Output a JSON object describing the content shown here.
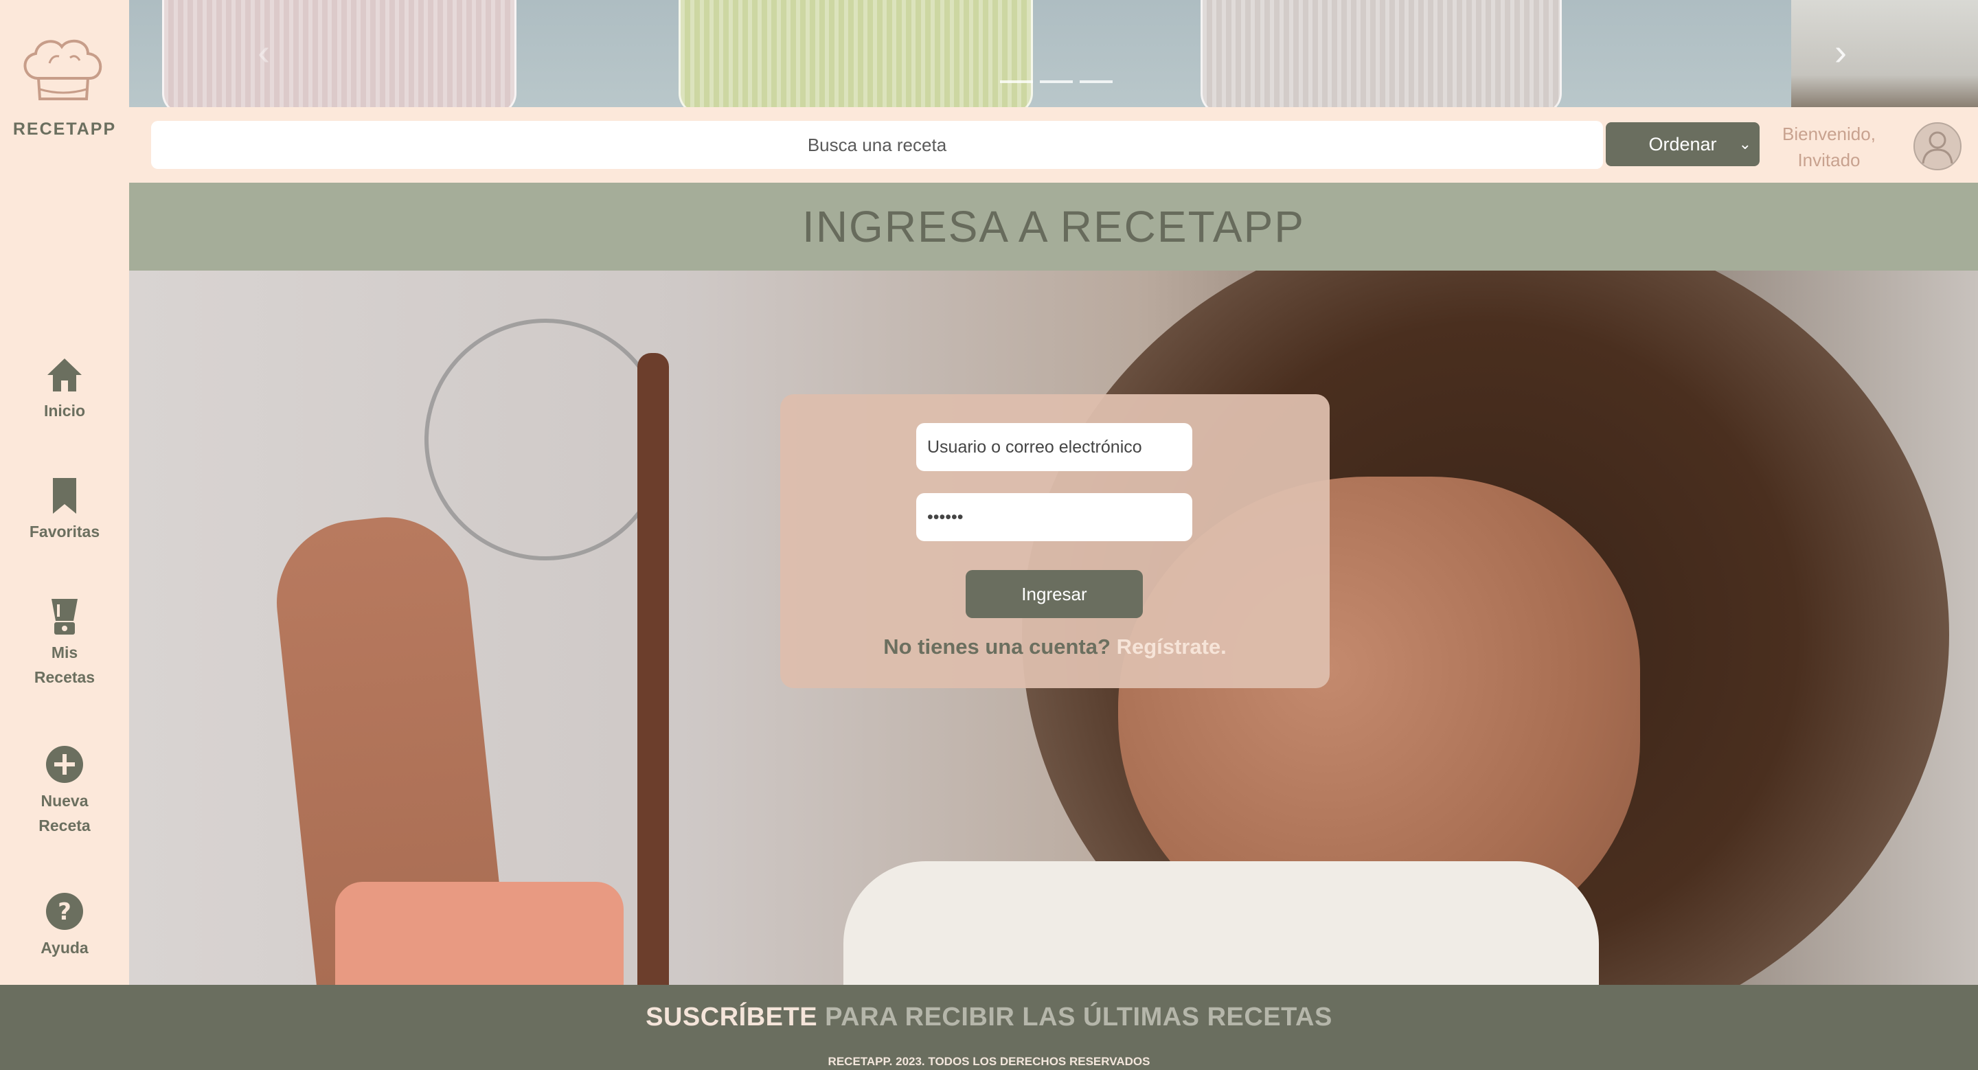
{
  "brand": {
    "name": "RECETAPP",
    "logo_icon": "chef-hat-icon"
  },
  "sidebar": {
    "items": [
      {
        "label": "Inicio",
        "icon": "home-icon"
      },
      {
        "label": "Favoritas",
        "icon": "bookmark-icon"
      },
      {
        "label": "Mis\nRecetas",
        "icon": "blender-icon"
      },
      {
        "label": "Nueva\nReceta",
        "icon": "plus-circle-icon"
      },
      {
        "label": "Ayuda",
        "icon": "question-circle-icon"
      }
    ]
  },
  "carousel": {
    "prev_icon": "chevron-left-icon",
    "next_icon": "chevron-right-icon",
    "slides": 3,
    "prev_glyph": "‹",
    "next_glyph": "›"
  },
  "search": {
    "placeholder": "Busca una receta",
    "value": ""
  },
  "order": {
    "label": "Ordenar",
    "chevron": "⌄"
  },
  "user": {
    "greeting_line1": "Bienvenido,",
    "greeting_line2": "Invitado",
    "avatar_icon": "user-avatar-icon"
  },
  "page": {
    "title": "INGRESA A RECETAPP"
  },
  "login": {
    "username_placeholder": "Usuario o correo electrónico",
    "password_value": "******",
    "submit_label": "Ingresar",
    "signup_prompt": "No tienes una cuenta?",
    "signup_link": "Regístrate."
  },
  "footer": {
    "subscribe_strong": "SUSCRÍBETE",
    "subscribe_rest": "PARA RECIBIR LAS ÚLTIMAS RECETAS",
    "copyright": "RECETAPP. 2023. TODOS LOS DERECHOS RESERVADOS"
  },
  "colors": {
    "sidebar_bg": "#fce8da",
    "accent_olive": "#6a6e5f",
    "title_band": "#a5ad99",
    "login_card": "#ddbead",
    "greeting": "#c8a28f"
  }
}
